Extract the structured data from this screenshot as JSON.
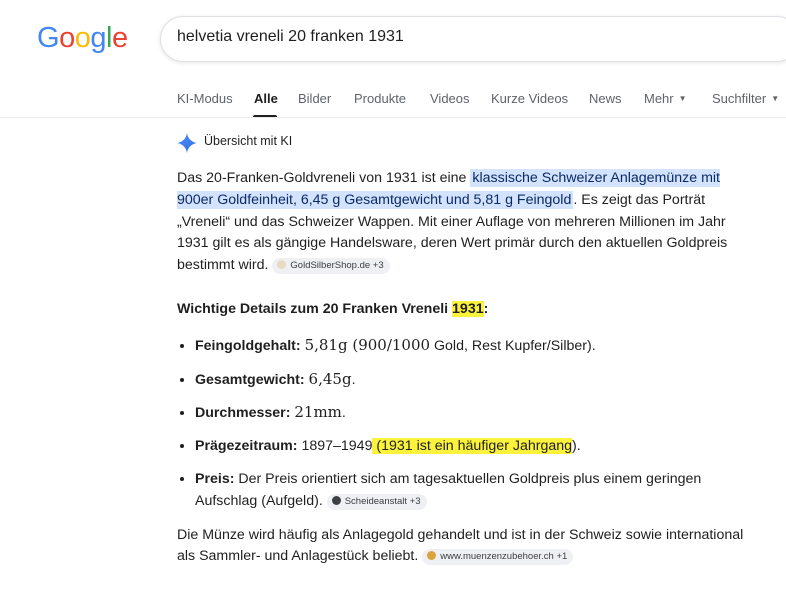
{
  "logo": {
    "letters": [
      "G",
      "o",
      "o",
      "g",
      "l",
      "e"
    ],
    "colors": [
      "#4285f4",
      "#ea4335",
      "#fbbc05",
      "#4285f4",
      "#34a853",
      "#ea4335"
    ]
  },
  "search": {
    "query": "helvetia vreneli 20 franken 1931"
  },
  "tabs": [
    {
      "label": "KI-Modus"
    },
    {
      "label": "Alle"
    },
    {
      "label": "Bilder"
    },
    {
      "label": "Produkte"
    },
    {
      "label": "Videos"
    },
    {
      "label": "Kurze Videos"
    },
    {
      "label": "News"
    },
    {
      "label": "Mehr"
    },
    {
      "label": "Suchfilter"
    }
  ],
  "ai": {
    "header": "Übersicht mit KI",
    "p1_start": "Das 20-Franken-Goldvreneli von 1931 ist eine ",
    "p1_highlight": "klassische Schweizer Anlagemünze mit 900er Goldfeinheit, 6,45 g Gesamtgewicht und 5,81 g Feingold",
    "p1_end": ". Es zeigt das Porträt „Vreneli“ und das Schweizer Wappen. Mit einer Auflage von mehreren Millionen im Jahr 1931 gilt es als gängige Handelsware, deren Wert primär durch den aktuellen Goldpreis bestimmt wird.",
    "chip1": "GoldSilberShop.de +3",
    "heading_start": "Wichtige Details zum 20 Franken Vreneli ",
    "heading_year": "1931",
    "heading_end": ":",
    "bullets": {
      "b1_label": "Feingoldgehalt:",
      "b1_math": "5,81g (900/1000",
      "b1_rest": " Gold, Rest Kupfer/Silber).",
      "b2_label": "Gesamtgewicht:",
      "b2_math": "6,45g",
      "b2_rest": ".",
      "b3_label": "Durchmesser:",
      "b3_math": "21mm",
      "b3_rest": ".",
      "b4_label": "Prägezeitraum:",
      "b4_text": " 1897–1949",
      "b4_highlight": " (1931 ist ein häufiger Jahrgang",
      "b4_rest": ").",
      "b5_label": "Preis:",
      "b5_text": " Der Preis orientiert sich am tagesaktuellen Goldpreis plus einem geringen Aufschlag (Aufgeld).",
      "chip2": "Scheideanstalt +3"
    },
    "last": "Die Münze wird häufig als Anlagegold gehandelt und ist in der Schweiz sowie international als Sammler- und Anlagestück beliebt.",
    "chip3": "www.muenzenzubehoer.ch +1"
  }
}
